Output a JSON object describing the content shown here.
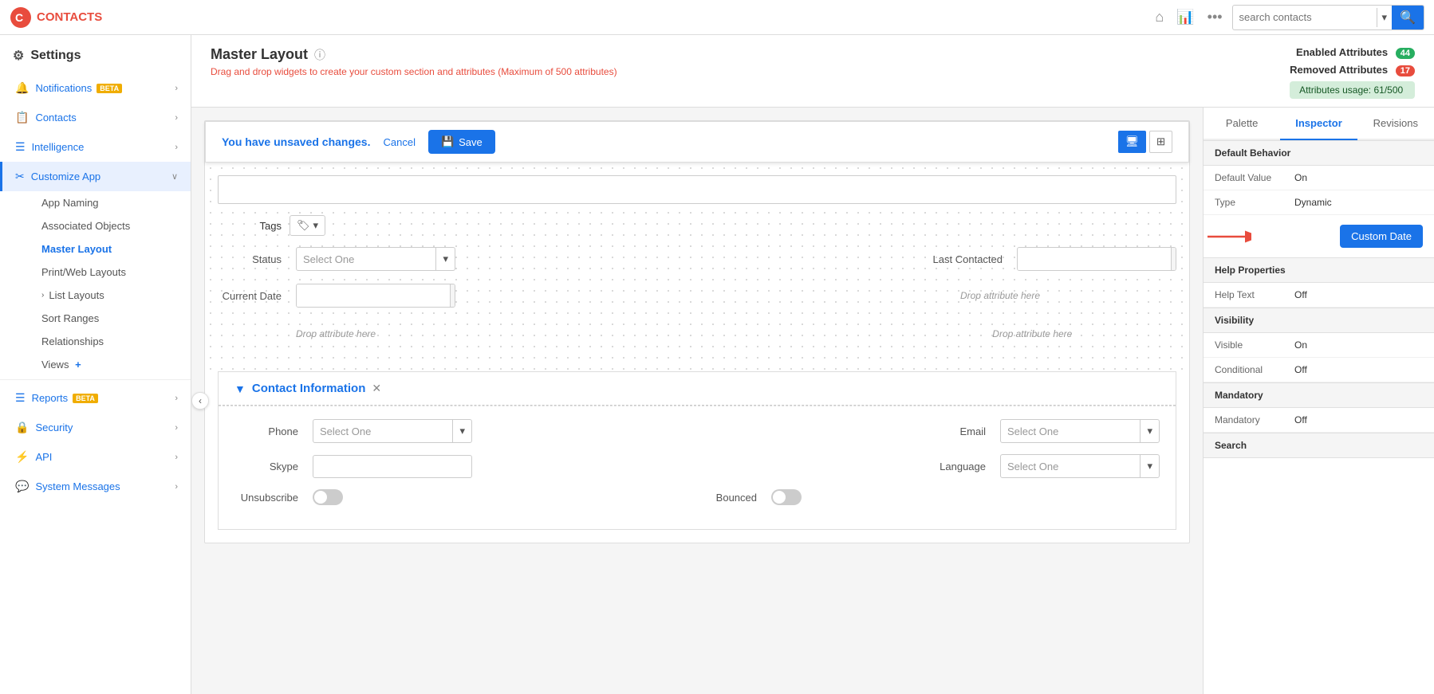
{
  "app": {
    "name": "CONTACTS",
    "logo_color": "#e84c3d"
  },
  "topnav": {
    "search_placeholder": "search contacts",
    "more_label": "...",
    "home_icon": "🏠",
    "chart_icon": "📊"
  },
  "sidebar": {
    "title": "Settings",
    "items": [
      {
        "id": "notifications",
        "label": "Notifications",
        "badge": "BETA",
        "icon": "🔔",
        "has_arrow": true
      },
      {
        "id": "contacts",
        "label": "Contacts",
        "icon": "📋",
        "has_arrow": true
      },
      {
        "id": "intelligence",
        "label": "Intelligence",
        "icon": "☰",
        "has_arrow": true
      },
      {
        "id": "customize-app",
        "label": "Customize App",
        "icon": "⚒",
        "has_arrow": false,
        "expanded": true
      }
    ],
    "sub_items": [
      {
        "id": "app-naming",
        "label": "App Naming"
      },
      {
        "id": "associated-objects",
        "label": "Associated Objects"
      },
      {
        "id": "master-layout",
        "label": "Master Layout",
        "active": true
      },
      {
        "id": "print-web-layouts",
        "label": "Print/Web Layouts"
      },
      {
        "id": "list-layouts",
        "label": "List Layouts",
        "with_arrow": true
      },
      {
        "id": "sort-ranges",
        "label": "Sort Ranges"
      },
      {
        "id": "relationships",
        "label": "Relationships"
      },
      {
        "id": "views",
        "label": "Views",
        "with_plus": true
      }
    ],
    "bottom_items": [
      {
        "id": "reports",
        "label": "Reports",
        "badge": "BETA",
        "icon": "☰",
        "has_arrow": true
      },
      {
        "id": "security",
        "label": "Security",
        "icon": "🔒",
        "has_arrow": true
      },
      {
        "id": "api",
        "label": "API",
        "icon": "⚡",
        "has_arrow": true
      },
      {
        "id": "system-messages",
        "label": "System Messages",
        "icon": "💬",
        "has_arrow": true
      }
    ]
  },
  "page": {
    "title": "Master Layout",
    "subtitle": "Drag and drop widgets to create your custom section and attributes (Maximum of 500 attributes)",
    "enabled_attributes_label": "Enabled Attributes",
    "enabled_attributes_count": "44",
    "removed_attributes_label": "Removed Attributes",
    "removed_attributes_count": "17",
    "attributes_usage": "Attributes usage: 61/500"
  },
  "unsaved_banner": {
    "message": "You have unsaved changes.",
    "cancel_label": "Cancel",
    "save_label": "Save"
  },
  "form": {
    "tags_label": "Tags",
    "status_label": "Status",
    "status_placeholder": "Select One",
    "last_contacted_label": "Last Contacted",
    "current_date_label": "Current Date",
    "drop_here_1": "Drop attribute here",
    "drop_here_2": "Drop attribute here",
    "drop_here_3": "Drop attribute here",
    "contact_section_title": "Contact Information",
    "phone_label": "Phone",
    "phone_placeholder": "Select One",
    "email_label": "Email",
    "email_placeholder": "Select One",
    "skype_label": "Skype",
    "language_label": "Language",
    "language_placeholder": "Select One",
    "unsubscribe_label": "Unsubscribe",
    "bounced_label": "Bounced"
  },
  "right_panel": {
    "tabs": [
      {
        "id": "palette",
        "label": "Palette"
      },
      {
        "id": "inspector",
        "label": "Inspector",
        "active": true
      },
      {
        "id": "revisions",
        "label": "Revisions"
      }
    ],
    "inspector": {
      "default_behavior_header": "Default Behavior",
      "default_value_label": "Default Value",
      "default_value": "On",
      "type_label": "Type",
      "type_value": "Dynamic",
      "custom_date_label": "Custom Date",
      "help_properties_header": "Help Properties",
      "help_text_label": "Help Text",
      "help_text_value": "Off",
      "visibility_header": "Visibility",
      "visible_label": "Visible",
      "visible_value": "On",
      "conditional_label": "Conditional",
      "conditional_value": "Off",
      "mandatory_header": "Mandatory",
      "mandatory_label": "Mandatory",
      "mandatory_value": "Off",
      "search_header": "Search"
    }
  }
}
